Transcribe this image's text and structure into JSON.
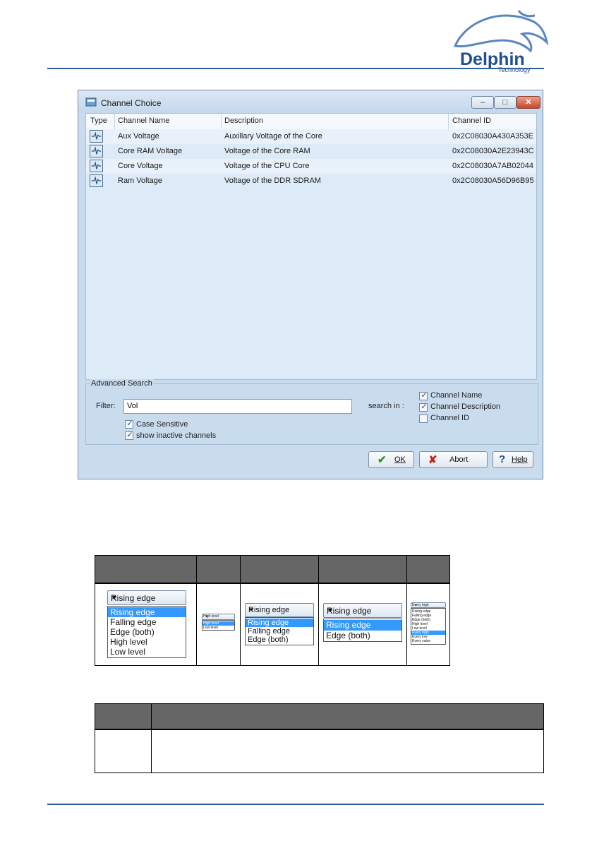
{
  "logo": {
    "brand": "Delphin",
    "sub": "Technology"
  },
  "window": {
    "title": "Channel Choice",
    "columns": [
      "Type",
      "Channel Name",
      "Description",
      "Channel ID"
    ],
    "rows": [
      {
        "name": "Aux Voltage",
        "description": "Auxillary Voltage of the Core",
        "id": "0x2C08030A430A353E"
      },
      {
        "name": "Core RAM Voltage",
        "description": "Voltage of the Core RAM",
        "id": "0x2C08030A2E23943C"
      },
      {
        "name": "Core Voltage",
        "description": "Voltage of the CPU Core",
        "id": "0x2C08030A7AB02044"
      },
      {
        "name": "Ram Voltage",
        "description": "Voltage of the DDR SDRAM",
        "id": "0x2C08030A56D96B95"
      }
    ],
    "advanced_search": {
      "group_label": "Advanced Search",
      "filter_label": "Filter:",
      "filter_value": "Vol",
      "case_sensitive_label": "Case Sensitive",
      "case_sensitive": true,
      "show_inactive_label": "show inactive channels",
      "show_inactive": true,
      "search_in_label": "search in :",
      "channel_name_label": "Channel Name",
      "channel_name": true,
      "channel_description_label": "Channel Description",
      "channel_description": true,
      "channel_id_label": "Channel ID",
      "channel_id": false
    },
    "buttons": {
      "ok": "OK",
      "abort": "Abort",
      "help": "Help"
    }
  },
  "dropdowns": {
    "large": {
      "selected": "Rising edge",
      "options": [
        "Rising edge",
        "Falling edge",
        "Edge (both)",
        "High level",
        "Low level"
      ],
      "highlight": "Rising edge"
    },
    "small": {
      "selected": "High level",
      "options": [
        "High level",
        "Low level"
      ],
      "highlight": "High level"
    },
    "medium": {
      "selected": "Rising edge",
      "options": [
        "Rising edge",
        "Falling edge",
        "Edge (both)"
      ],
      "highlight": "Rising edge"
    },
    "medium2": {
      "selected": "Rising edge",
      "options": [
        "Rising edge",
        "Edge (both)"
      ],
      "highlight": "Rising edge"
    },
    "tiny": {
      "selected": "Every high",
      "options": [
        "Rising edge",
        "Falling edge",
        "Edge (both)",
        "High level",
        "Low level",
        "Every high",
        "Every low",
        "Every value"
      ],
      "highlight": "Every high"
    }
  },
  "colors": {
    "accent": "#2e5f99",
    "header_gray": "#666666",
    "selection": "#3399ff"
  }
}
